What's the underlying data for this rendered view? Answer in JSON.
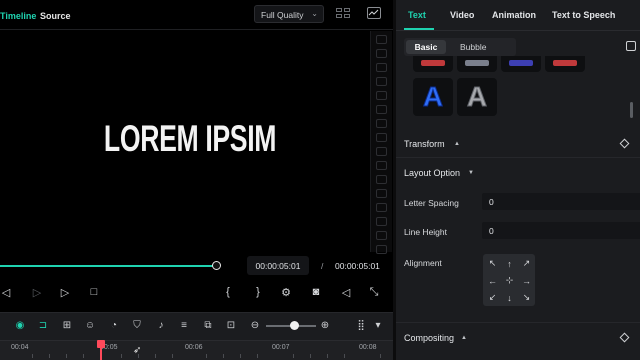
{
  "player": {
    "tabs": {
      "timeline": "Timeline",
      "source": "Source"
    },
    "quality": "Full Quality",
    "canvas_text": "LOREM IPSIM",
    "progress_fraction": 0.55,
    "timecode_current": "00:00:05:01",
    "timecode_separator": "/",
    "timecode_total": "00:00:05:01",
    "controls": [
      {
        "name": "previous-frame-icon",
        "glyph": "◁",
        "dim": false
      },
      {
        "name": "next-frame-icon",
        "glyph": "▷",
        "dim": true
      },
      {
        "name": "play-icon",
        "glyph": "▷",
        "dim": false
      },
      {
        "name": "stop-icon",
        "glyph": "□",
        "dim": false
      },
      {
        "name": "mark-in-icon",
        "glyph": "{",
        "dim": false
      },
      {
        "name": "mark-out-icon",
        "glyph": "}",
        "dim": false
      },
      {
        "name": "render-settings-icon",
        "glyph": "⚙",
        "dim": false
      },
      {
        "name": "snapshot-icon",
        "glyph": "◙",
        "dim": false
      },
      {
        "name": "volume-icon",
        "glyph": "◁",
        "dim": false
      },
      {
        "name": "fullscreen-icon",
        "glyph": "⤡",
        "dim": false
      }
    ]
  },
  "timeline": {
    "tools": [
      {
        "name": "ai-tool-icon",
        "glyph": "◉",
        "accent": true
      },
      {
        "name": "split-icon",
        "glyph": "⊐",
        "accent": true
      },
      {
        "name": "add-media-icon",
        "glyph": "⊞",
        "accent": false
      },
      {
        "name": "sticker-icon",
        "glyph": "☺",
        "accent": false
      },
      {
        "name": "speed-icon",
        "glyph": "◔",
        "accent": false
      },
      {
        "name": "shield-icon",
        "glyph": "⛉",
        "accent": false
      },
      {
        "name": "microphone-icon",
        "glyph": "♪",
        "accent": false
      },
      {
        "name": "audio-mixer-icon",
        "glyph": "≡",
        "accent": false
      },
      {
        "name": "replace-icon",
        "glyph": "⧉",
        "accent": false
      },
      {
        "name": "fit-icon",
        "glyph": "⊡",
        "accent": false
      },
      {
        "name": "zoom-out-icon",
        "glyph": "⊖",
        "accent": false
      },
      {
        "name": "zoom-in-icon",
        "glyph": "⊕",
        "accent": false
      },
      {
        "name": "track-layout-icon",
        "glyph": "⣿",
        "accent": false
      },
      {
        "name": "more-dropdown-icon",
        "glyph": "▾",
        "accent": false
      }
    ],
    "zoom_level": 0.55,
    "ruler_labels": [
      "00:04",
      "00:05",
      "00:06",
      "00:07",
      "00:08"
    ]
  },
  "inspector": {
    "tabs": [
      "Text",
      "Video",
      "Animation",
      "Text to Speech"
    ],
    "active_tab": "Text",
    "segment": {
      "basic": "Basic",
      "bubble": "Bubble"
    },
    "preset_top_colors": [
      "#c0393b",
      "#7a7f8c",
      "#3d3fb3",
      "#c0393b"
    ],
    "presets": [
      {
        "glyph": "A",
        "color": "#2f6df6"
      },
      {
        "glyph": "A",
        "color": "#a7a9ad"
      }
    ],
    "transform": "Transform",
    "layout_option": "Layout Option",
    "letter_spacing_label": "Letter Spacing",
    "letter_spacing_value": "0",
    "line_height_label": "Line Height",
    "line_height_value": "0",
    "alignment_label": "Alignment",
    "alignment_cells": [
      "↖",
      "↑",
      "↗",
      "←",
      "⊹",
      "→",
      "↙",
      "↓",
      "↘"
    ],
    "compositing": "Compositing"
  }
}
